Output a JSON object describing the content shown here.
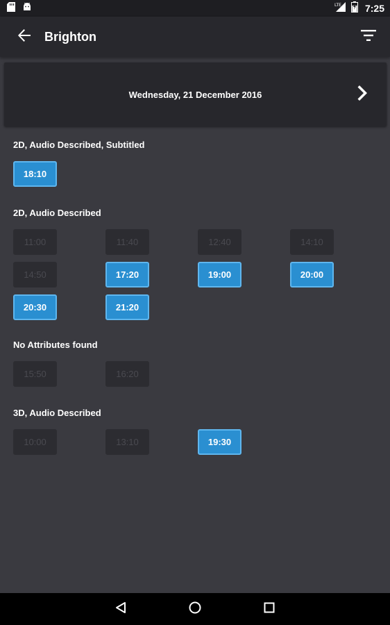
{
  "status_bar": {
    "time": "7:25",
    "network": "LTE",
    "icons": [
      "sd-card-icon",
      "android-icon",
      "signal-icon",
      "battery-icon"
    ]
  },
  "app_bar": {
    "title": "Brighton",
    "back_icon": "arrow-back-icon",
    "filter_icon": "filter-icon"
  },
  "date_selector": {
    "date": "Wednesday, 21 December 2016",
    "next_icon": "chevron-right-icon"
  },
  "colors": {
    "background": "#3a3a40",
    "available": "#2a8fd1",
    "unavailable": "#2c2c31"
  },
  "sections": [
    {
      "title": "2D, Audio Described, Subtitled",
      "times": [
        {
          "time": "18:10",
          "available": true
        }
      ]
    },
    {
      "title": "2D, Audio Described",
      "times": [
        {
          "time": "11:00",
          "available": false
        },
        {
          "time": "11:40",
          "available": false
        },
        {
          "time": "12:40",
          "available": false
        },
        {
          "time": "14:10",
          "available": false
        },
        {
          "time": "14:50",
          "available": false
        },
        {
          "time": "17:20",
          "available": true
        },
        {
          "time": "19:00",
          "available": true
        },
        {
          "time": "20:00",
          "available": true
        },
        {
          "time": "20:30",
          "available": true
        },
        {
          "time": "21:20",
          "available": true
        }
      ]
    },
    {
      "title": "No Attributes found",
      "times": [
        {
          "time": "15:50",
          "available": false
        },
        {
          "time": "16:20",
          "available": false
        }
      ]
    },
    {
      "title": "3D, Audio Described",
      "times": [
        {
          "time": "10:00",
          "available": false
        },
        {
          "time": "13:10",
          "available": false
        },
        {
          "time": "19:30",
          "available": true
        }
      ]
    }
  ],
  "nav_bar": {
    "icons": [
      "back-triangle-icon",
      "home-circle-icon",
      "recents-square-icon"
    ]
  }
}
